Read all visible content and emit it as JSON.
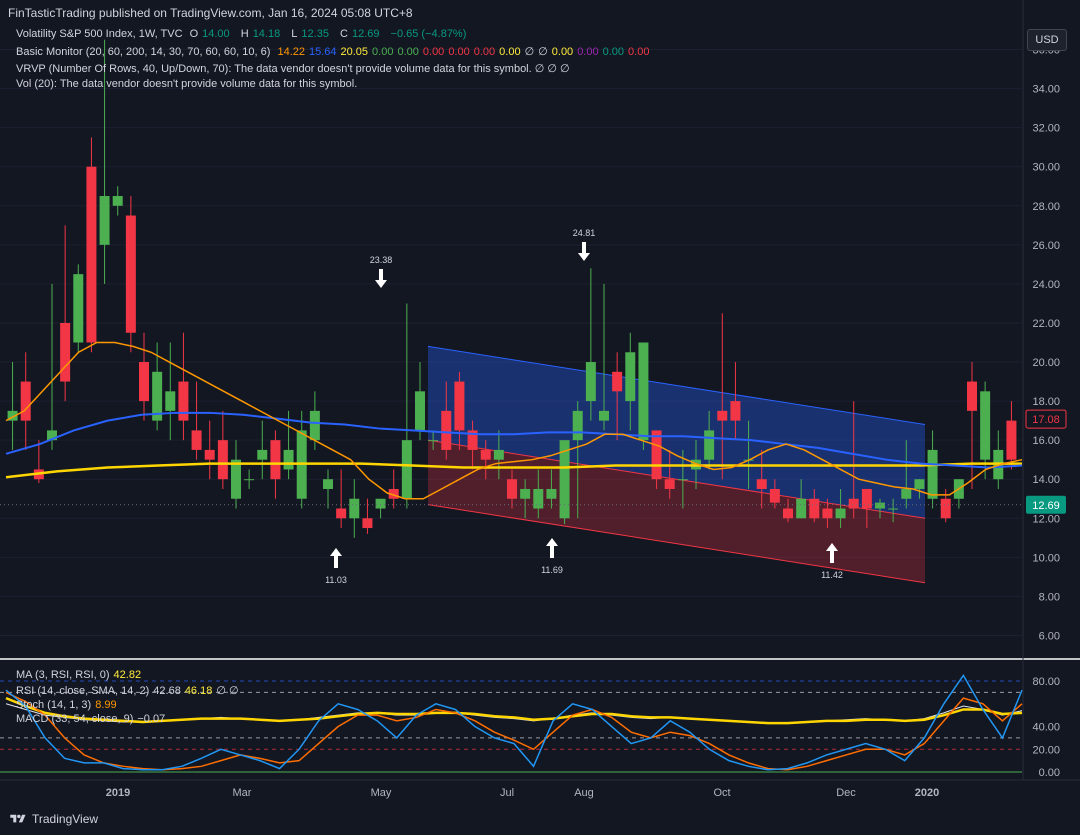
{
  "header": {
    "publisher_line": "FinTasticTrading published on TradingView.com, Jan 16, 2024 05:08 UTC+8"
  },
  "legend": {
    "symbol": "Volatility S&P 500 Index, 1W, TVC",
    "o_label": "O",
    "o": "14.00",
    "h_label": "H",
    "h": "14.18",
    "l_label": "L",
    "l": "12.35",
    "c_label": "C",
    "c": "12.69",
    "change": "−0.65 (−4.87%)",
    "basic_monitor": "Basic Monitor (20, 60, 200, 14, 30, 70, 60, 60, 10, 6)",
    "bm_values": [
      {
        "v": "14.22",
        "color": "#ff9800"
      },
      {
        "v": "15.64",
        "color": "#2962ff"
      },
      {
        "v": "20.05",
        "color": "#ffeb3b"
      },
      {
        "v": "0.00",
        "color": "#4caf50"
      },
      {
        "v": "0.00",
        "color": "#4caf50"
      },
      {
        "v": "0.00",
        "color": "#f23645"
      },
      {
        "v": "0.00",
        "color": "#f23645"
      },
      {
        "v": "0.00",
        "color": "#f23645"
      },
      {
        "v": "0.00",
        "color": "#ffeb3b"
      },
      {
        "v": "∅",
        "color": "#d1d4dc"
      },
      {
        "v": "∅",
        "color": "#d1d4dc"
      },
      {
        "v": "0.00",
        "color": "#ffeb3b"
      },
      {
        "v": "0.00",
        "color": "#9c27b0"
      },
      {
        "v": "0.00",
        "color": "#089981"
      },
      {
        "v": "0.00",
        "color": "#f23645"
      }
    ],
    "vrvp": "VRVP (Number Of Rows, 40, Up/Down, 70): The data vendor doesn't provide volume data for this symbol.  ∅  ∅  ∅",
    "vol": "Vol (20): The data vendor doesn't provide volume data for this symbol."
  },
  "currency_button": "USD",
  "price_axis": {
    "labels": [
      "36.00",
      "34.00",
      "32.00",
      "30.00",
      "28.00",
      "26.00",
      "24.00",
      "22.00",
      "20.00",
      "18.00",
      "16.00",
      "14.00",
      "12.00",
      "10.00",
      "8.00",
      "6.00"
    ],
    "current_price": "12.69",
    "current_color": "#089981",
    "prev_price": "17.08",
    "prev_color": "#f23645"
  },
  "time_axis": {
    "labels": [
      "2019",
      "Mar",
      "May",
      "Jul",
      "Aug",
      "Oct",
      "Dec",
      "2020"
    ]
  },
  "annotations": [
    {
      "text": "23.38",
      "dir": "down"
    },
    {
      "text": "24.81",
      "dir": "down"
    },
    {
      "text": "11.03",
      "dir": "up"
    },
    {
      "text": "11.69",
      "dir": "up"
    },
    {
      "text": "11.42",
      "dir": "up"
    }
  ],
  "lower_pane": {
    "ma": "MA (3, RSI, RSI, 0)",
    "ma_val": "42.82",
    "rsi": "RSI (14, close, SMA, 14, 2)",
    "rsi_val1": "42.68",
    "rsi_val2": "46.18",
    "rsi_tail": "∅  ∅",
    "stoch": "Stoch (14, 1, 3)",
    "stoch_val": "8.99",
    "macd": "MACD (33, 54, close, 9)",
    "macd_val": "−0.07",
    "axis": [
      "80.00",
      "40.00",
      "20.00",
      "0.00"
    ]
  },
  "footer": {
    "brand": "TradingView"
  },
  "chart_data": {
    "type": "candlestick",
    "title": "Volatility S&P 500 Index, 1W, TVC",
    "ylim": [
      5,
      37
    ],
    "candles": [
      [
        17.0,
        20.0,
        17.5,
        15.5
      ],
      [
        19.0,
        20.5,
        17.0,
        15.5
      ],
      [
        14.5,
        16.0,
        14.0,
        13.8
      ],
      [
        16.0,
        24.0,
        16.5,
        15.5
      ],
      [
        22.0,
        27.0,
        19.0,
        18.0
      ],
      [
        21.0,
        25.0,
        24.5,
        20.5
      ],
      [
        30.0,
        31.5,
        21.0,
        20.5
      ],
      [
        26.0,
        36.5,
        28.5,
        24.0
      ],
      [
        28.0,
        29.0,
        28.5,
        27.5
      ],
      [
        27.5,
        28.5,
        21.5,
        20.5
      ],
      [
        20.0,
        21.5,
        18.0,
        17.0
      ],
      [
        17.0,
        21.0,
        19.5,
        16.5
      ],
      [
        17.5,
        21.0,
        18.5,
        16.0
      ],
      [
        19.0,
        21.5,
        17.0,
        16.0
      ],
      [
        16.5,
        19.0,
        15.5,
        15.0
      ],
      [
        15.5,
        17.0,
        15.0,
        14.0
      ],
      [
        16.0,
        17.5,
        14.0,
        13.5
      ],
      [
        13.0,
        16.0,
        15.0,
        12.5
      ],
      [
        14.0,
        14.5,
        14.0,
        13.5
      ],
      [
        15.0,
        17.0,
        15.5,
        14.0
      ],
      [
        16.0,
        16.5,
        14.0,
        13.0
      ],
      [
        14.5,
        17.5,
        15.5,
        14.0
      ],
      [
        13.0,
        17.5,
        16.5,
        12.5
      ],
      [
        16.0,
        18.5,
        17.5,
        15.5
      ],
      [
        13.5,
        14.5,
        14.0,
        12.5
      ],
      [
        12.5,
        14.5,
        12.0,
        11.5
      ],
      [
        12.0,
        14.0,
        13.0,
        11.0
      ],
      [
        12.0,
        13.0,
        11.5,
        11.2
      ],
      [
        12.5,
        13.0,
        13.0,
        12.0
      ],
      [
        13.5,
        14.5,
        13.0,
        12.5
      ],
      [
        13.0,
        23.0,
        16.0,
        12.5
      ],
      [
        16.5,
        20.0,
        18.5,
        16.0
      ],
      [
        16.0,
        16.5,
        16.0,
        15.5
      ],
      [
        17.5,
        19.0,
        15.5,
        15.0
      ],
      [
        19.0,
        19.5,
        16.5,
        15.5
      ],
      [
        16.5,
        17.0,
        15.5,
        14.5
      ],
      [
        15.5,
        16.0,
        15.0,
        14.0
      ],
      [
        15.0,
        16.5,
        15.5,
        14.0
      ],
      [
        14.0,
        14.5,
        13.0,
        12.5
      ],
      [
        13.0,
        14.0,
        13.5,
        12.0
      ],
      [
        12.5,
        14.5,
        13.5,
        12.0
      ],
      [
        13.0,
        14.5,
        13.5,
        12.5
      ],
      [
        12.0,
        14.0,
        16.0,
        11.7
      ],
      [
        16.0,
        18.0,
        17.5,
        12.0
      ],
      [
        18.0,
        24.8,
        20.0,
        17.0
      ],
      [
        17.0,
        24.0,
        17.5,
        16.5
      ],
      [
        19.5,
        20.5,
        18.5,
        16.0
      ],
      [
        18.0,
        21.5,
        20.5,
        16.5
      ],
      [
        16.0,
        21.0,
        21.0,
        15.5
      ],
      [
        16.5,
        16.0,
        14.0,
        13.5
      ],
      [
        14.0,
        15.5,
        13.5,
        13.0
      ],
      [
        14.0,
        15.5,
        14.0,
        12.5
      ],
      [
        14.5,
        16.0,
        15.0,
        13.5
      ],
      [
        15.0,
        17.5,
        16.5,
        14.5
      ],
      [
        17.5,
        22.5,
        17.0,
        14.0
      ],
      [
        18.0,
        20.0,
        17.0,
        16.0
      ],
      [
        15.0,
        17.0,
        15.0,
        13.5
      ],
      [
        14.0,
        15.5,
        13.5,
        12.5
      ],
      [
        13.5,
        14.0,
        12.8,
        12.5
      ],
      [
        12.5,
        13.0,
        12.0,
        11.8
      ],
      [
        12.0,
        14.0,
        13.0,
        12.0
      ],
      [
        13.0,
        13.5,
        12.0,
        11.8
      ],
      [
        12.5,
        13.0,
        12.0,
        11.5
      ],
      [
        12.0,
        13.5,
        12.5,
        11.5
      ],
      [
        13.0,
        18.0,
        12.5,
        12.0
      ],
      [
        13.5,
        13.5,
        12.5,
        11.5
      ],
      [
        12.5,
        13.0,
        12.8,
        12.0
      ],
      [
        12.5,
        13.0,
        12.5,
        11.8
      ],
      [
        13.0,
        16.0,
        13.5,
        12.5
      ],
      [
        13.5,
        14.0,
        14.0,
        13.0
      ],
      [
        13.0,
        16.5,
        15.5,
        12.5
      ],
      [
        13.0,
        13.5,
        12.0,
        11.8
      ],
      [
        13.0,
        14.0,
        14.0,
        12.5
      ],
      [
        19.0,
        20.0,
        17.5,
        13.5
      ],
      [
        15.0,
        19.0,
        18.5,
        14.0
      ],
      [
        14.0,
        16.5,
        15.5,
        13.5
      ],
      [
        17.0,
        18.0,
        15.0,
        14.5
      ]
    ],
    "sma20": [
      17,
      17.5,
      18.5,
      19.5,
      20.5,
      21,
      21,
      20.8,
      20.5,
      20,
      19.5,
      19,
      18.5,
      18,
      17.5,
      17,
      16.5,
      16,
      15.5,
      15,
      14,
      13.3,
      13,
      13,
      13.5,
      14,
      14.5,
      14.8,
      14.9,
      15,
      15.2,
      15.5,
      15.8,
      16.3,
      16.3,
      16,
      15.7,
      15.2,
      14.8,
      14.5,
      14.6,
      15,
      15.5,
      15.8,
      15.5,
      15,
      14.5,
      14,
      13.8,
      13.6,
      13.5,
      13.2,
      13.2,
      13.8,
      14.5,
      14.8,
      15
    ],
    "sma60": [
      15.3,
      15.8,
      16.5,
      17,
      17.3,
      17.4,
      17.4,
      17.3,
      17.1,
      16.9,
      16.8,
      16.6,
      16.5,
      16.4,
      16.3,
      16.3,
      16.4,
      16.4,
      16.3,
      16.2,
      16.2,
      16.1,
      16,
      15.8,
      15.6,
      15.3,
      15.0,
      14.8,
      14.7,
      14.6,
      14.7
    ],
    "sma200": [
      14.1,
      14.4,
      14.6,
      14.7,
      14.8,
      14.8,
      14.8,
      14.8,
      14.7,
      14.6,
      14.6,
      14.6,
      14.7,
      14.7,
      14.7,
      14.7,
      14.7,
      14.7,
      14.7,
      14.8,
      14.8
    ],
    "channel": {
      "upper": [
        20.8,
        16.8
      ],
      "mid": [
        16.0,
        12.0
      ],
      "lower": [
        12.7,
        8.7
      ]
    },
    "lower_series": {
      "blue": [
        72,
        58,
        30,
        12,
        8,
        8,
        3,
        2,
        2,
        5,
        12,
        20,
        15,
        10,
        3,
        20,
        45,
        60,
        55,
        45,
        30,
        50,
        60,
        55,
        40,
        30,
        25,
        5,
        45,
        60,
        55,
        40,
        25,
        30,
        45,
        35,
        20,
        10,
        5,
        2,
        3,
        8,
        15,
        20,
        25,
        20,
        10,
        30,
        60,
        85,
        55,
        30,
        72
      ],
      "orange": [
        70,
        62,
        50,
        30,
        15,
        8,
        5,
        3,
        2,
        3,
        5,
        10,
        15,
        12,
        8,
        10,
        25,
        40,
        50,
        50,
        45,
        48,
        55,
        52,
        45,
        35,
        28,
        20,
        35,
        50,
        55,
        48,
        35,
        30,
        35,
        32,
        25,
        15,
        8,
        3,
        2,
        5,
        10,
        15,
        20,
        20,
        15,
        25,
        45,
        65,
        60,
        45,
        60
      ],
      "white": [
        60,
        55,
        50,
        48,
        46,
        45,
        44,
        44,
        45,
        46,
        47,
        48,
        47,
        46,
        45,
        46,
        48,
        50,
        52,
        52,
        50,
        50,
        52,
        52,
        50,
        48,
        47,
        45,
        47,
        50,
        52,
        50,
        48,
        47,
        48,
        47,
        46,
        45,
        44,
        43,
        43,
        44,
        45,
        46,
        47,
        46,
        45,
        47,
        52,
        58,
        55,
        50,
        54
      ],
      "yellow": [
        65,
        58,
        52,
        49,
        47,
        46,
        45,
        44,
        45,
        46,
        47,
        47,
        47,
        46,
        45,
        46,
        47,
        49,
        51,
        52,
        51,
        51,
        52,
        52,
        51,
        49,
        48,
        46,
        47,
        49,
        51,
        51,
        49,
        48,
        48,
        47,
        46,
        45,
        44,
        43,
        43,
        44,
        45,
        45,
        46,
        46,
        45,
        46,
        50,
        55,
        55,
        51,
        52
      ]
    }
  }
}
